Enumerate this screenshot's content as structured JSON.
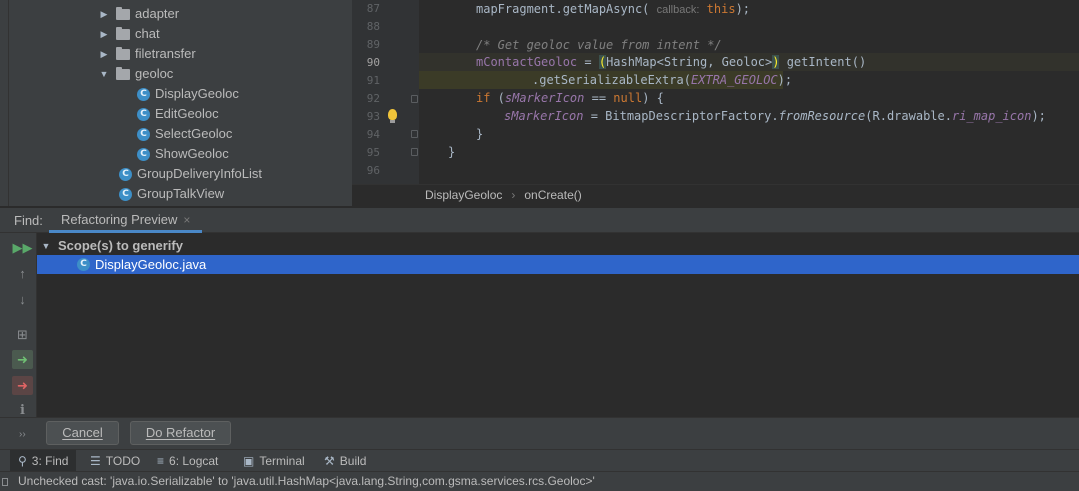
{
  "project_tree": {
    "items": [
      {
        "name": "adapter",
        "kind": "folder",
        "expanded": false
      },
      {
        "name": "chat",
        "kind": "folder",
        "expanded": false
      },
      {
        "name": "filetransfer",
        "kind": "folder",
        "expanded": false
      },
      {
        "name": "geoloc",
        "kind": "folder",
        "expanded": true
      },
      {
        "name": "DisplayGeoloc",
        "kind": "class"
      },
      {
        "name": "EditGeoloc",
        "kind": "class"
      },
      {
        "name": "SelectGeoloc",
        "kind": "class"
      },
      {
        "name": "ShowGeoloc",
        "kind": "class"
      },
      {
        "name": "GroupDeliveryInfoList",
        "kind": "class"
      },
      {
        "name": "GroupTalkView",
        "kind": "class"
      }
    ]
  },
  "editor": {
    "line_numbers": [
      "87",
      "88",
      "89",
      "90",
      "91",
      "92",
      "93",
      "94",
      "95",
      "96"
    ],
    "current_line": "90",
    "code": {
      "l87_a": "mapFragment.getMapAsync( ",
      "l87_hint": "callback:",
      "l87_kw": "this",
      "l87_end": ");",
      "l89_comment": "/* Get geoloc value from intent */",
      "l90_field": "mContactGeoloc",
      "l90_eq": " = ",
      "l90_open": "(",
      "l90_type": "HashMap<String, Geoloc>",
      "l90_close": ")",
      "l90_call": " getIntent()",
      "l91_call": ".getSerializableExtra(",
      "l91_const": "EXTRA_GEOLOC",
      "l91_end": ");",
      "l92_kw": "if",
      "l92_a": " (",
      "l92_field": "sMarkerIcon",
      "l92_b": " == ",
      "l92_null": "null",
      "l92_c": ") {",
      "l93_field": "sMarkerIcon",
      "l93_a": " = BitmapDescriptorFactory.",
      "l93_method": "fromResource",
      "l93_b": "(R.drawable.",
      "l93_res": "ri_map_icon",
      "l93_c": ");",
      "l94": "}",
      "l95": "}"
    },
    "breadcrumb": {
      "class_name": "DisplayGeoloc",
      "separator": "›",
      "method": "onCreate()"
    }
  },
  "find_window": {
    "label": "Find:",
    "tab_label": "Refactoring Preview",
    "tab_close": "×",
    "scope_label": "Scope(s) to generify",
    "file_item": "DisplayGeoloc.java",
    "toolbar_icons": [
      "rerun-icon",
      "previous-occurrence-icon",
      "next-occurrence-icon",
      "group-icon",
      "include-icon",
      "exclude-icon",
      "info-icon",
      "expand-icon"
    ]
  },
  "buttons": {
    "cancel": "Cancel",
    "do_refactor": "Do Refactor"
  },
  "tool_tabs": [
    {
      "label": "3: Find",
      "icon": "search-icon",
      "active": true
    },
    {
      "label": "TODO",
      "icon": "list-icon",
      "active": false
    },
    {
      "label": "6: Logcat",
      "icon": "logcat-icon",
      "active": false
    },
    {
      "label": "Terminal",
      "icon": "terminal-icon",
      "active": false
    },
    {
      "label": "Build",
      "icon": "hammer-icon",
      "active": false
    }
  ],
  "status_bar": {
    "message": "Unchecked cast: 'java.io.Serializable' to 'java.util.HashMap<java.lang.String,com.gsma.services.rcs.Geoloc>'"
  },
  "colors": {
    "accent": "#4a88c7",
    "selection": "#2f65ca",
    "keyword": "#cc7832",
    "field": "#9876aa",
    "comment": "#808080"
  }
}
